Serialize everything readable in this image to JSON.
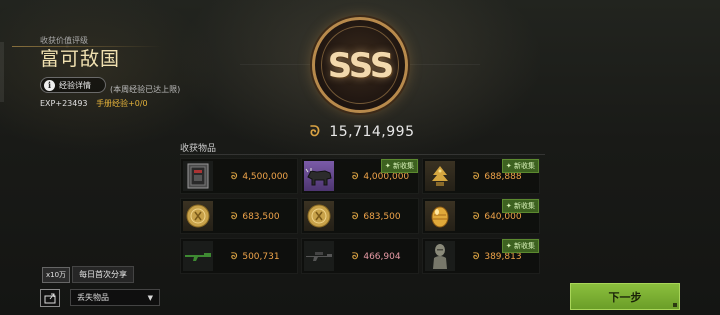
{
  "header": {
    "subtitle": "收获价值评级",
    "rank_title": "富可敌国",
    "exp_button_label": "经验详情",
    "exp_cap_note": "(本周经验已达上限)",
    "exp_value": "EXP+23493",
    "handbook_exp": "手册经验+0/0"
  },
  "badge": {
    "grade": "SSS"
  },
  "total": {
    "coin_icon": "ᘐ",
    "amount": "15,714,995"
  },
  "loot": {
    "title": "收获物品",
    "new_label": "✦ 新收集",
    "items": [
      {
        "value": "4,500,000",
        "icon": "safe-box-icon",
        "is_new": false,
        "accent": "orange"
      },
      {
        "value": "4,000,000",
        "icon": "bull-statue-icon",
        "is_new": true,
        "accent": "orange"
      },
      {
        "value": "688,888",
        "icon": "golden-tree-icon",
        "is_new": true,
        "accent": "orange"
      },
      {
        "value": "683,500",
        "icon": "gold-coin-icon",
        "is_new": false,
        "accent": "orange"
      },
      {
        "value": "683,500",
        "icon": "gold-coin-icon",
        "is_new": false,
        "accent": "orange"
      },
      {
        "value": "640,000",
        "icon": "golden-egg-icon",
        "is_new": true,
        "accent": "orange"
      },
      {
        "value": "500,731",
        "icon": "rifle-icon",
        "is_new": false,
        "accent": "orange"
      },
      {
        "value": "466,904",
        "icon": "sniper-rifle-icon",
        "is_new": false,
        "accent": "pink"
      },
      {
        "value": "389,813",
        "icon": "stone-bust-icon",
        "is_new": true,
        "accent": "orange"
      }
    ]
  },
  "share": {
    "multiplier": "x10万",
    "label": "每日首次分享"
  },
  "lost_items": {
    "selected": "丢失物品"
  },
  "next_button": {
    "label": "下一步"
  },
  "colors": {
    "accent_gold": "#d9a243",
    "value_orange": "#efa44a",
    "value_pink": "#e69aa4",
    "next_green": "#7fb335"
  }
}
